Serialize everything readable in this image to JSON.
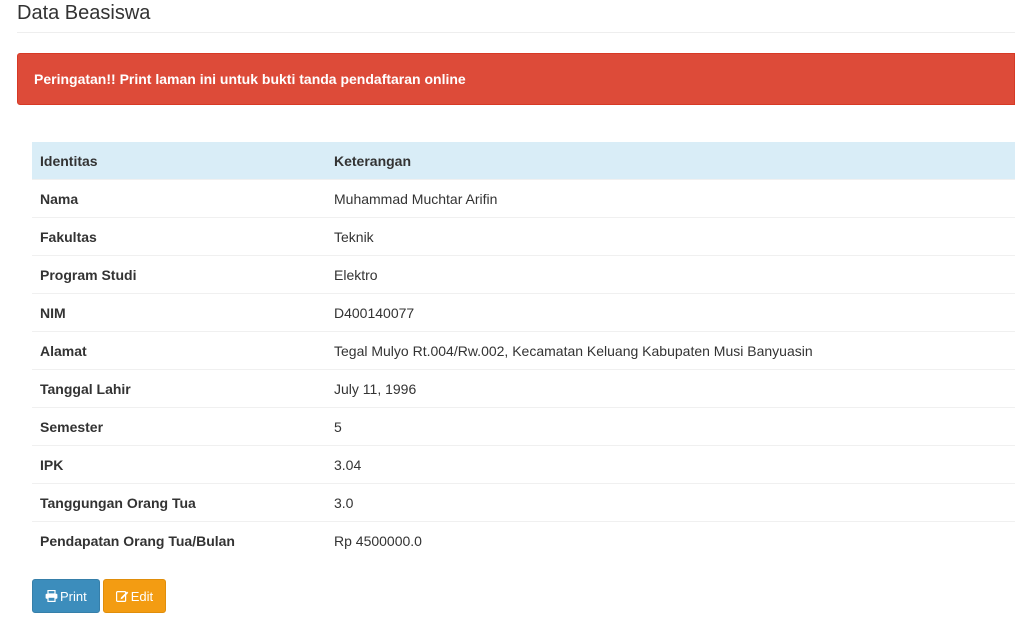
{
  "page": {
    "title": "Data Beasiswa"
  },
  "alert": {
    "text": "Peringatan!! Print laman ini untuk bukti tanda pendaftaran online",
    "color": "#dd4b39"
  },
  "table": {
    "headers": [
      "Identitas",
      "Keterangan"
    ],
    "rows": [
      {
        "label": "Nama",
        "value": "Muhammad Muchtar Arifin"
      },
      {
        "label": "Fakultas",
        "value": "Teknik"
      },
      {
        "label": "Program Studi",
        "value": "Elektro"
      },
      {
        "label": "NIM",
        "value": "D400140077"
      },
      {
        "label": "Alamat",
        "value": "Tegal Mulyo Rt.004/Rw.002, Kecamatan Keluang Kabupaten Musi Banyuasin"
      },
      {
        "label": "Tanggal Lahir",
        "value": "July 11, 1996"
      },
      {
        "label": "Semester",
        "value": "5"
      },
      {
        "label": "IPK",
        "value": "3.04"
      },
      {
        "label": "Tanggungan Orang Tua",
        "value": "3.0"
      },
      {
        "label": "Pendapatan Orang Tua/Bulan",
        "value": "Rp 4500000.0"
      }
    ]
  },
  "actions": {
    "print_label": "Print",
    "print_icon": "print-icon",
    "print_color": "#3c8dbc",
    "edit_label": "Edit",
    "edit_icon": "edit-icon",
    "edit_color": "#f39c12"
  }
}
